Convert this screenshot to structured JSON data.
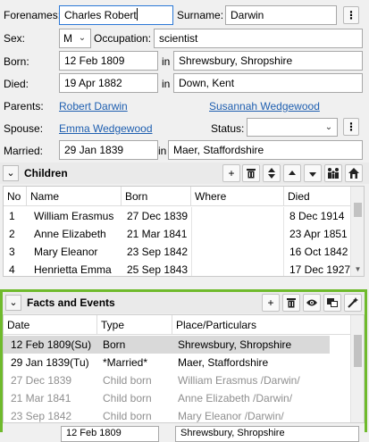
{
  "person": {
    "forenames_label": "Forenames:",
    "forenames_value": "Charles Robert",
    "surname_label": "Surname:",
    "surname_value": "Darwin",
    "more_btn": "⋮",
    "sex_label": "Sex:",
    "sex_value": "M",
    "occupation_label": "Occupation:",
    "occupation_value": "scientist",
    "born_label": "Born:",
    "born_date": "12 Feb 1809",
    "in_label": "in",
    "born_place": "Shrewsbury, Shropshire",
    "died_label": "Died:",
    "died_date": "19 Apr 1882",
    "died_place": "Down, Kent",
    "parents_label": "Parents:",
    "father": "Robert Darwin",
    "mother": "Susannah Wedgewood",
    "spouse_label": "Spouse:",
    "spouse": "Emma Wedgewood",
    "status_label": "Status:",
    "status_value": "",
    "married_label": "Married:",
    "married_date": "29 Jan 1839",
    "married_place": "Maer, Staffordshire"
  },
  "children": {
    "title": "Children",
    "columns": [
      "No",
      "Name",
      "Born",
      "Where",
      "Died"
    ],
    "rows": [
      {
        "no": "1",
        "name": "William Erasmus",
        "born": "27 Dec 1839",
        "where": "",
        "died": "8 Dec 1914"
      },
      {
        "no": "2",
        "name": "Anne Elizabeth",
        "born": "21 Mar 1841",
        "where": "",
        "died": "23 Apr 1851"
      },
      {
        "no": "3",
        "name": "Mary Eleanor",
        "born": "23 Sep 1842",
        "where": "",
        "died": "16 Oct 1842"
      },
      {
        "no": "4",
        "name": "Henrietta Emma",
        "born": "25 Sep 1843",
        "where": "",
        "died": "17 Dec 1927"
      }
    ]
  },
  "facts": {
    "title": "Facts and Events",
    "columns": [
      "Date",
      "Type",
      "Place/Particulars"
    ],
    "rows": [
      {
        "date": "12 Feb 1809(Su)",
        "type": "Born",
        "place": "Shrewsbury, Shropshire"
      },
      {
        "date": "29 Jan 1839(Tu)",
        "type": "*Married*",
        "place": "Maer, Staffordshire"
      },
      {
        "date": "27 Dec 1839",
        "type": "Child born",
        "place": "William Erasmus /Darwin/"
      },
      {
        "date": "21 Mar 1841",
        "type": "Child born",
        "place": "Anne Elizabeth /Darwin/"
      },
      {
        "date": "23 Sep 1842",
        "type": "Child born",
        "place": "Mary Eleanor /Darwin/"
      }
    ],
    "bottom_date": "12 Feb 1809",
    "bottom_place": "Shrewsbury, Shropshire"
  },
  "icons": {
    "expand": "chevron-down-icon",
    "add": "plus-icon",
    "delete": "trash-icon",
    "view": "eye-icon",
    "sort": "sort-icon",
    "up": "up-icon",
    "down": "down-icon",
    "family": "family-icon",
    "home": "home-icon"
  },
  "colors": {
    "link": "#1f5fb0",
    "focus": "#2b78d6",
    "highlight_border": "#6fba2c"
  }
}
